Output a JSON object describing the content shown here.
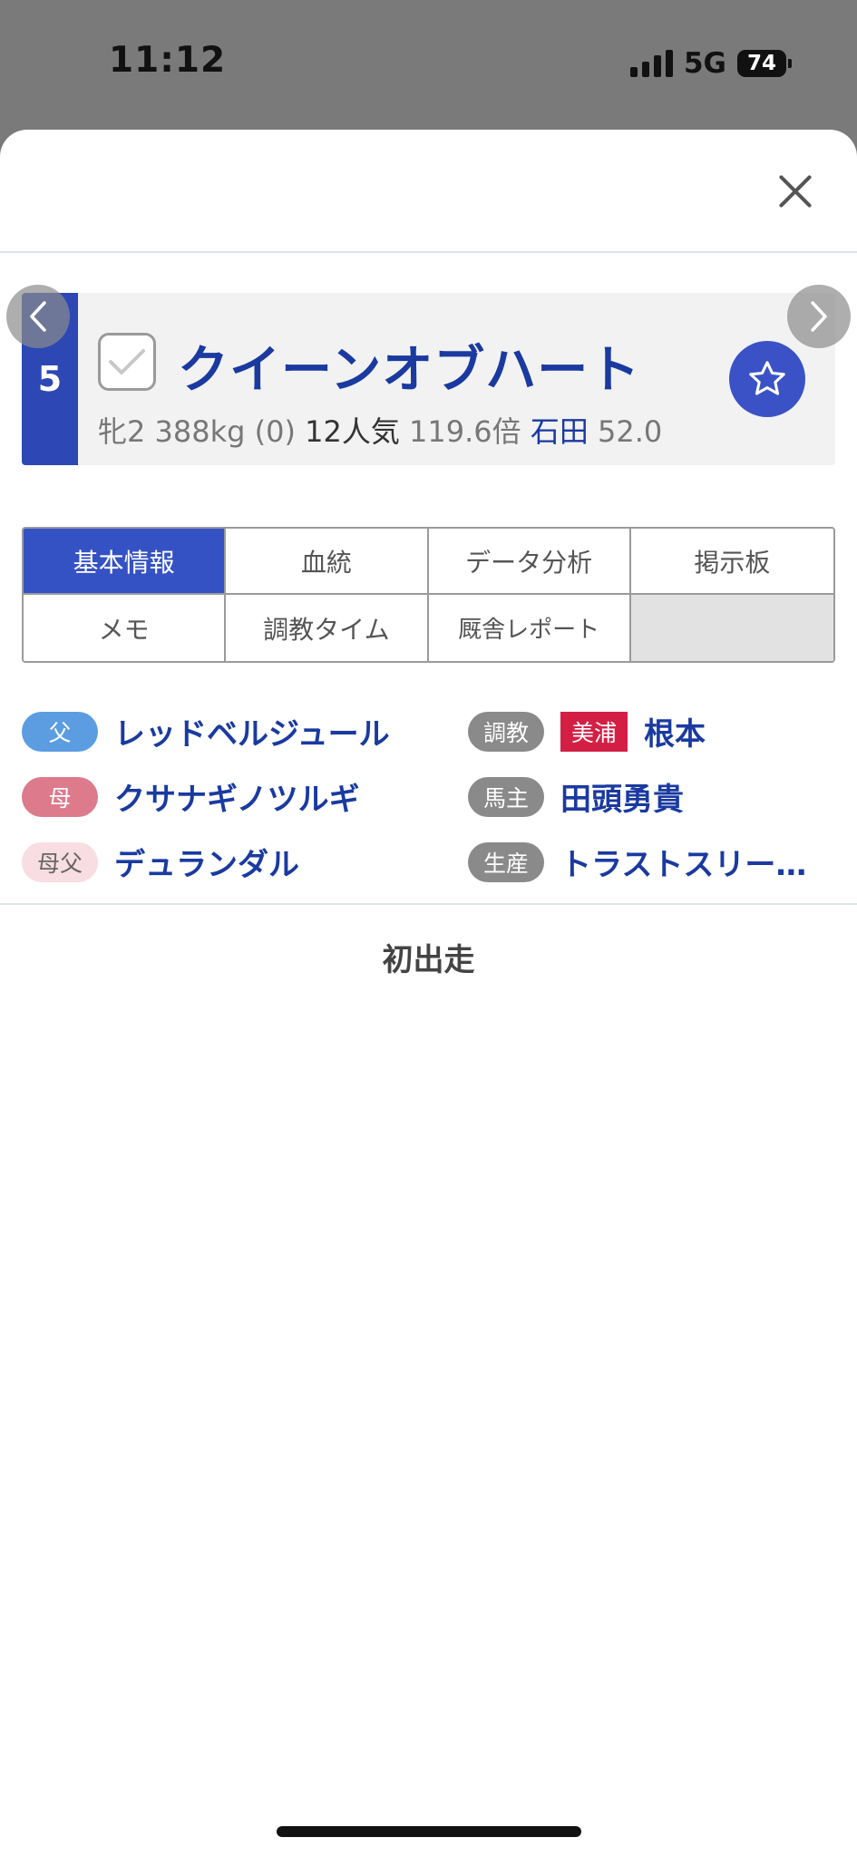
{
  "status_bar": {
    "time": "11:12",
    "network": "5G",
    "battery": "74"
  },
  "horse": {
    "number": "5",
    "name": "クイーンオブハート",
    "sex_age": "牝2",
    "weight": "388kg (0)",
    "popularity": "12人気",
    "odds": "119.6倍",
    "jockey": "石田",
    "jockey_weight": "52.0"
  },
  "tabs": [
    {
      "label": "基本情報",
      "active": true
    },
    {
      "label": "血統"
    },
    {
      "label": "データ分析"
    },
    {
      "label": "掲示板"
    },
    {
      "label": "メモ"
    },
    {
      "label": "調教タイム"
    },
    {
      "label": "厩舎レポート"
    },
    {
      "label": ""
    }
  ],
  "pedigree": {
    "father_label": "父",
    "father": "レッドベルジュール",
    "mother_label": "母",
    "mother": "クサナギノツルギ",
    "mf_label": "母父",
    "mf": "デュランダル"
  },
  "stable": {
    "trainer_label": "調教",
    "trainer_region": "美浦",
    "trainer": "根本",
    "owner_label": "馬主",
    "owner": "田頭勇貴",
    "breeder_label": "生産",
    "breeder": "トラストスリー…"
  },
  "history": {
    "message": "初出走"
  },
  "colors": {
    "accent": "#3552c4",
    "link": "#1a3aa0",
    "region": "#d41f45"
  }
}
